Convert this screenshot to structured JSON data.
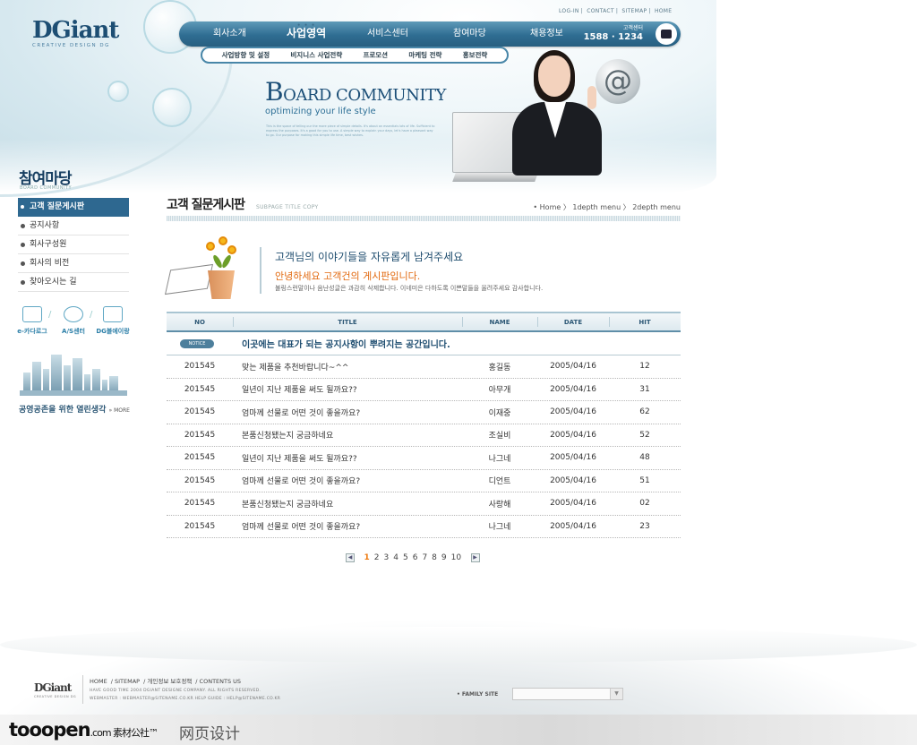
{
  "header": {
    "logo_main": "DGiant",
    "logo_sub": "CREATIVE DESIGN DG",
    "util_links": [
      "LOG-IN",
      "CONTACT",
      "SITEMAP",
      "HOME"
    ],
    "gnb": [
      {
        "label": "회사소개"
      },
      {
        "label": "사업영역",
        "active": true
      },
      {
        "label": "서비스센터"
      },
      {
        "label": "참여마당"
      },
      {
        "label": "채용정보"
      }
    ],
    "call_center_label": "고객센터",
    "call_center_number": "1588 · 1234",
    "sub_menu": [
      "사업방향 및 설정",
      "비지니스 사업전략",
      "프로모션",
      "마케팅 전략",
      "홍보전략"
    ]
  },
  "banner": {
    "title_first": "B",
    "title_rest": "OARD COMMUNITY",
    "tagline": "optimizing your life style",
    "description": "This is the space of telling our the more piece of simple details. It's about an essentials lots of life. Sufficient to express the purposes. It's a good for you to use. A simple way to explain your days, let's have a pleasant way to go. Our purpose for making this simple life time, best wishes."
  },
  "sidebar": {
    "title": "참여마당",
    "subtitle": "BOARD COMMUNITY",
    "items": [
      {
        "label": "고객 질문게시판",
        "active": true
      },
      {
        "label": "공지사항"
      },
      {
        "label": "회사구성원"
      },
      {
        "label": "회사의 비전"
      },
      {
        "label": "찾아오시는 길"
      }
    ],
    "quick_links": [
      "e-카다로그",
      "A/S센터",
      "DG블에이랑"
    ],
    "banner_text": "공영공존을 위한 열린생각",
    "banner_more": "» MORE"
  },
  "page": {
    "title": "고객 질문게시판",
    "title_sub": "SUBPAGE TITLE COPY",
    "breadcrumb": "• Home  〉 1depth menu 〉 2depth menu"
  },
  "intro": {
    "headline": "고객님의 이야기들을 자유롭게 남겨주세요",
    "orange": "안녕하세요 고객건의 게시판입니다.",
    "small": "불링스런말이나 음난성글은 과감히 삭제합니다. 이네미은 다하도록 이쁜말들을 올려주세요 감사합니다."
  },
  "board": {
    "columns": [
      "NO",
      "TITLE",
      "NAME",
      "DATE",
      "HIT"
    ],
    "notice_badge": "NOTICE",
    "notice_text": "이곳에는 대표가 되는 공지사항이 뿌려지는 공간입니다.",
    "rows": [
      {
        "no": "201545",
        "title": "맞는 제품을 추천바랍니다~^^",
        "name": "홍길동",
        "date": "2005/04/16",
        "hit": "12"
      },
      {
        "no": "201545",
        "title": "일년이 지난 제품을 써도 될까요??",
        "name": "아무개",
        "date": "2005/04/16",
        "hit": "31"
      },
      {
        "no": "201545",
        "title": "엄마께 선물로 어떤 것이 좋을까요?",
        "name": "이재중",
        "date": "2005/04/16",
        "hit": "62"
      },
      {
        "no": "201545",
        "title": "본품신청됐는지 궁금하네요",
        "name": "조실비",
        "date": "2005/04/16",
        "hit": "52"
      },
      {
        "no": "201545",
        "title": "일년이 지난 제품을 써도 될까요??",
        "name": "나그네",
        "date": "2005/04/16",
        "hit": "48"
      },
      {
        "no": "201545",
        "title": "엄마께 선물로 어떤 것이 좋을까요?",
        "name": "디언트",
        "date": "2005/04/16",
        "hit": "51"
      },
      {
        "no": "201545",
        "title": "본품신청됐는지 궁금하네요",
        "name": "사랑해",
        "date": "2005/04/16",
        "hit": "02"
      },
      {
        "no": "201545",
        "title": "엄마께 선물로 어떤 것이 좋을까요?",
        "name": "나그네",
        "date": "2005/04/16",
        "hit": "23"
      }
    ]
  },
  "pager": {
    "prev": "◀",
    "next": "▶",
    "pages": [
      "1",
      "2",
      "3",
      "4",
      "5",
      "6",
      "7",
      "8",
      "9",
      "10"
    ],
    "current": "1"
  },
  "footer": {
    "logo": "DGiant",
    "logo_sub": "CREATIVE DESIGN DG",
    "links": [
      "HOME",
      "SITEMAP",
      "개인정보 보호정책",
      "CONTENTS US"
    ],
    "copy1": "HAVE GOOD TIME 2004 DGIANT DESIGNE COMPANY. ALL RIGHTS RESERVED.",
    "copy2": "WEBMASTER : WEBMASTER@SITENAME.CO.KR  HELP GUIDE : HELP@SITENAME.CO.KR",
    "family_site_label": "• FAMILY SITE",
    "family_site_value": ""
  },
  "watermark": {
    "brand": "tooopen",
    "brand_suffix": ".com 素材公社™",
    "category": "网页设计"
  }
}
